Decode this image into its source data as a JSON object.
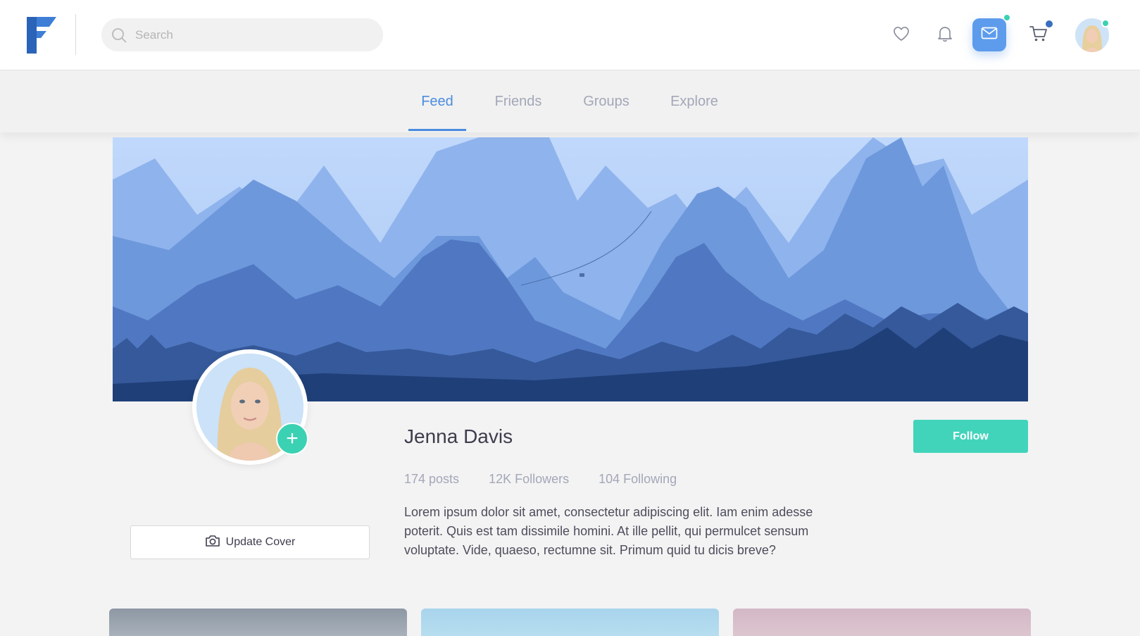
{
  "header": {
    "search_placeholder": "Search",
    "icons": [
      "heart-icon",
      "bell-icon",
      "mail-icon",
      "cart-icon"
    ],
    "accent_color": "#5d9cec",
    "notification_color": "#3bd1b3"
  },
  "tabs": [
    {
      "label": "Feed",
      "active": true
    },
    {
      "label": "Friends",
      "active": false
    },
    {
      "label": "Groups",
      "active": false
    },
    {
      "label": "Explore",
      "active": false
    }
  ],
  "profile": {
    "name": "Jenna Davis",
    "stats": {
      "posts": "174 posts",
      "followers": "12K Followers",
      "following": "104 Following"
    },
    "bio": "Lorem ipsum dolor sit amet, consectetur adipiscing elit. Iam enim adesse poterit. Quis est tam dissimile homini. At ille pellit, qui permulcet sensum voluptate. Vide, quaeso, rectumne sit. Primum quid tu dicis breve?",
    "follow_label": "Follow",
    "update_cover_label": "Update Cover",
    "follow_color": "#42d4bb"
  }
}
